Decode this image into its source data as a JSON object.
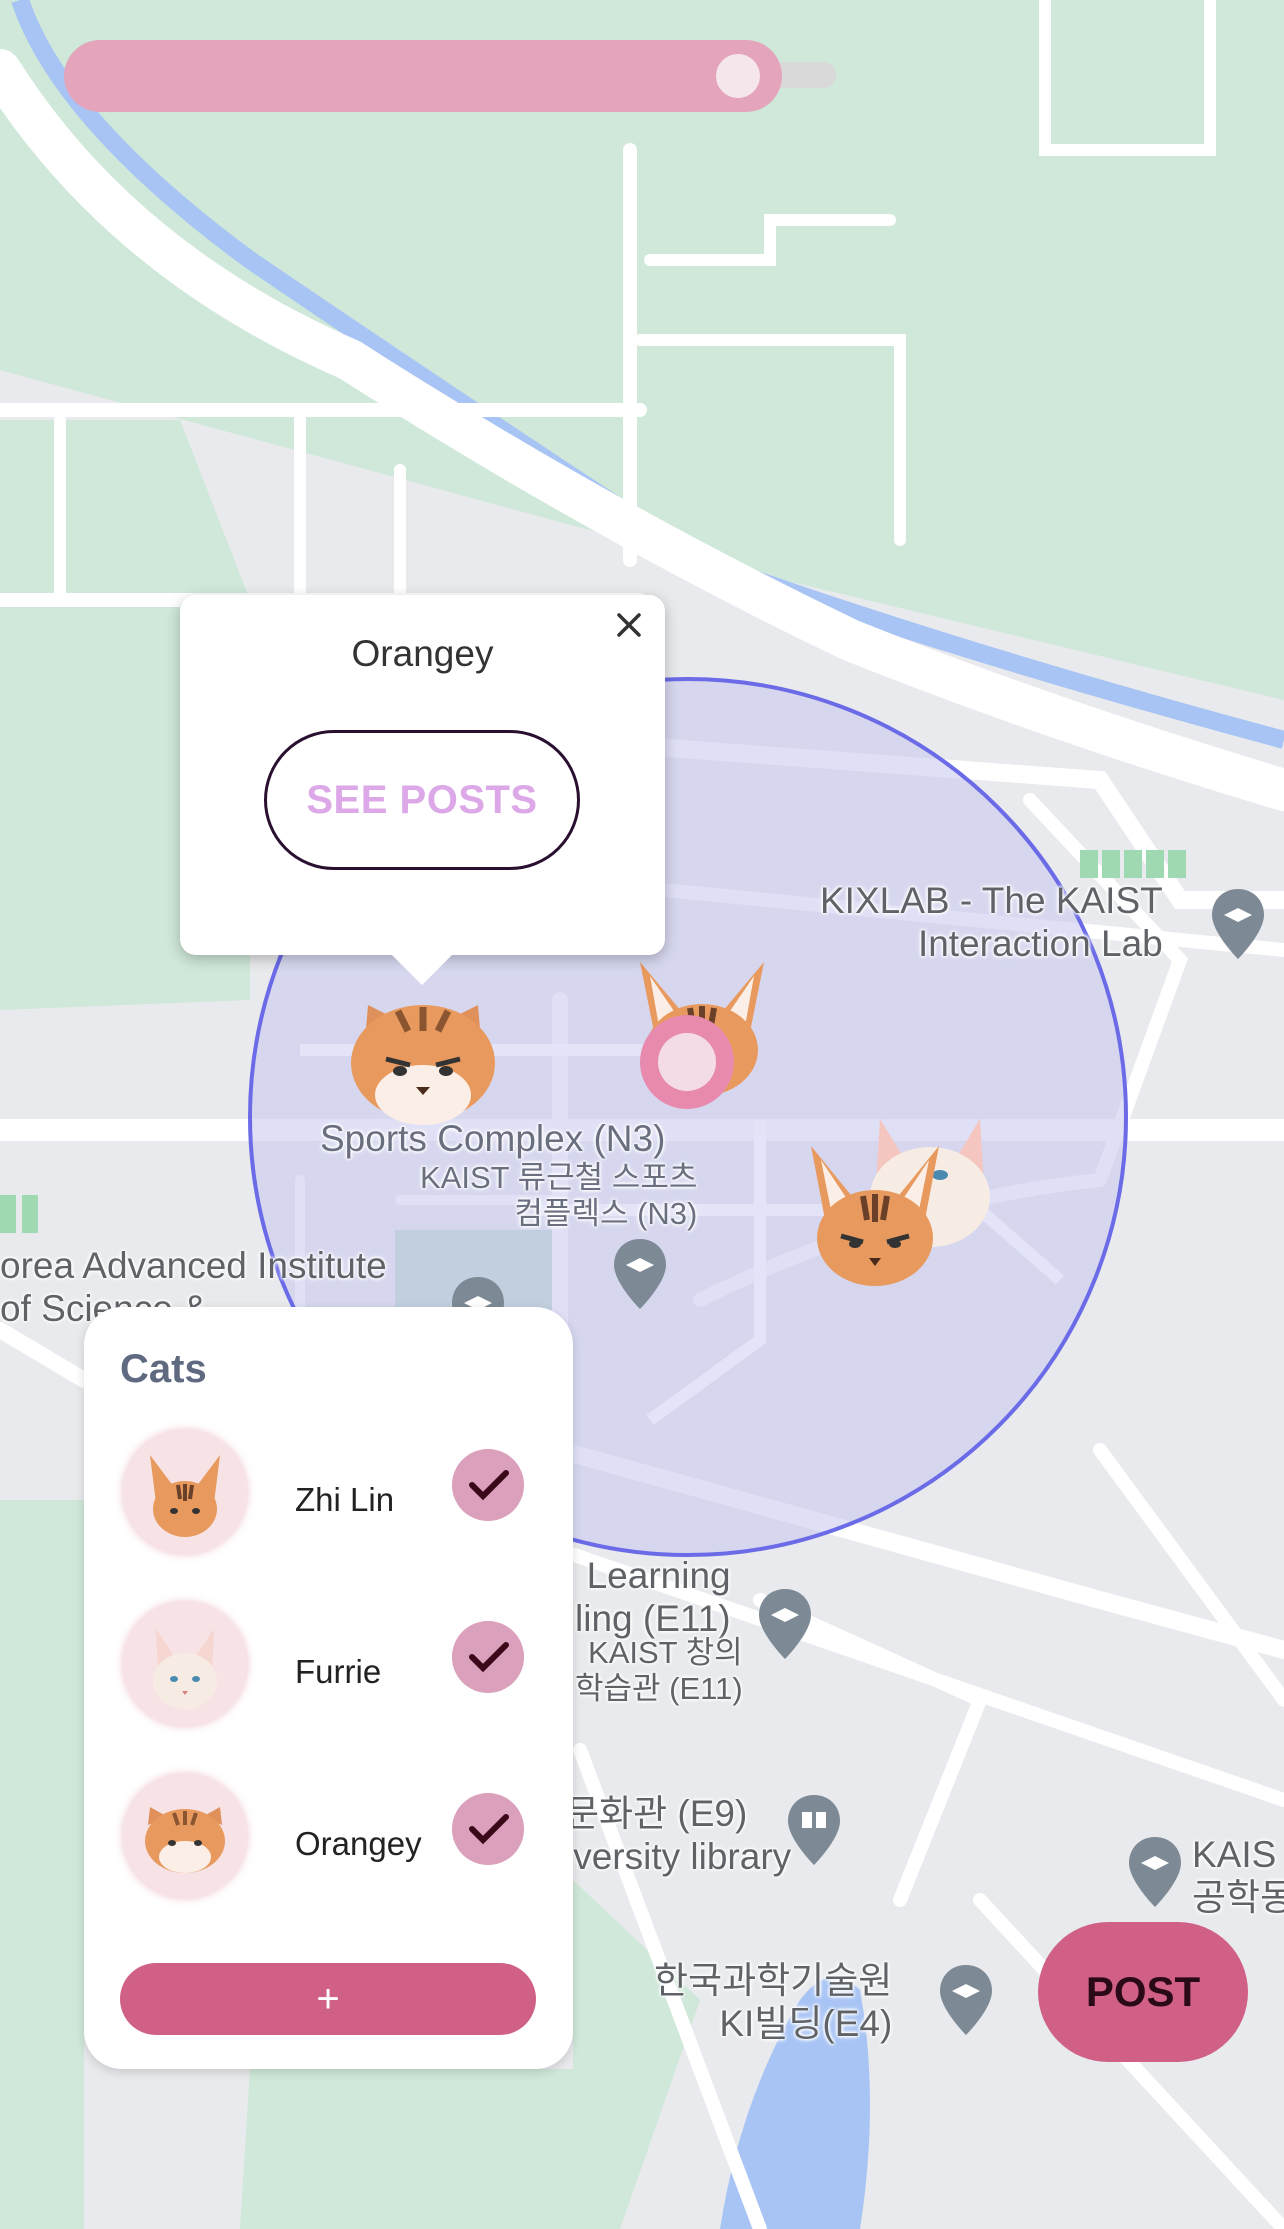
{
  "popup": {
    "title": "Orangey",
    "button_label": "SEE POSTS"
  },
  "slider": {
    "value_fraction": 0.87
  },
  "map_labels": {
    "kixlab": "KIXLAB - The KAIST\nInteraction Lab",
    "sports_complex": "Sports Complex (N3)",
    "sports_complex_ko": "KAIST 류근철 스포츠\n컴플렉스 (N3)",
    "korea_advanced": "orea Advanced Institute\nof Science &",
    "learning": "Learning\nling (E11)",
    "learning_ko": "KAIST 창의\n학습관 (E11)",
    "library": "문화관 (E9)\niversity library",
    "kaist_right": "KAIS\n공학동",
    "ki_building": "한국과학기술원\nKI빌딩(E4)"
  },
  "cats_panel": {
    "title": "Cats",
    "items": [
      {
        "name": "Zhi Lin",
        "checked": true,
        "avatar_icon": "abyssinian-cat-icon"
      },
      {
        "name": "Furrie",
        "checked": true,
        "avatar_icon": "white-cat-icon"
      },
      {
        "name": "Orangey",
        "checked": true,
        "avatar_icon": "orange-cat-icon"
      }
    ],
    "add_label": "+"
  },
  "post_button": {
    "label": "POST"
  },
  "colors": {
    "accent_pink": "#d06086",
    "light_pink": "#e3a4bc",
    "circle_fill": "#c9caf0",
    "circle_stroke": "#6b6be8",
    "map_green": "#cfe8d9",
    "water": "#a8c4f5"
  }
}
